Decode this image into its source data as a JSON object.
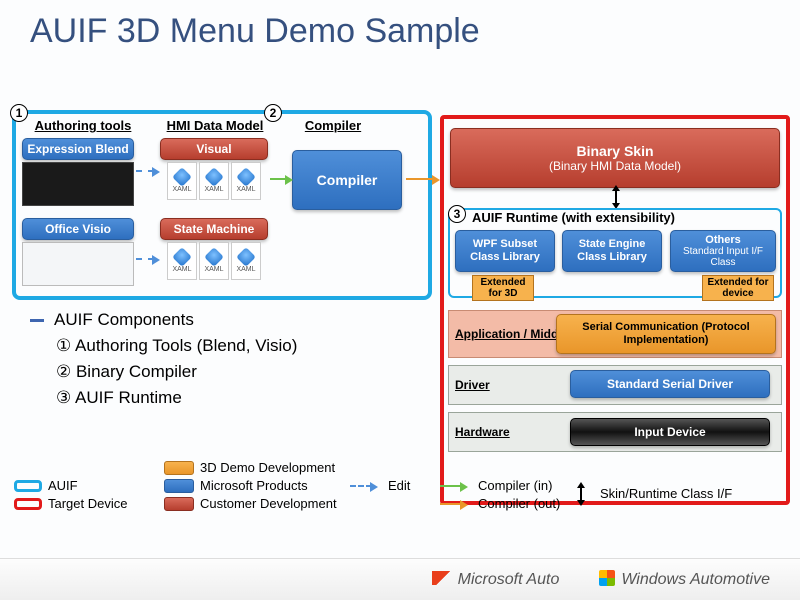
{
  "title": "AUIF 3D Menu Demo Sample",
  "nums": {
    "n1": "1",
    "n2": "2",
    "n3": "3"
  },
  "cols": {
    "authoring": "Authoring tools",
    "hmi": "HMI Data Model",
    "compiler": "Compiler"
  },
  "tools": {
    "blend": "Expression Blend",
    "visio": "Office Visio"
  },
  "hmi": {
    "visual": "Visual",
    "state": "State Machine",
    "xaml": "XAML"
  },
  "compiler": {
    "box": "Compiler"
  },
  "target": {
    "binary_skin": "Binary Skin",
    "binary_skin_sub": "(Binary HMI Data Model)",
    "runtime": "AUIF Runtime (with extensibility)",
    "wpf": "WPF Subset Class Library",
    "state_engine": "State Engine Class Library",
    "others": "Others",
    "others_sub": "Standard Input I/F Class",
    "ext_3d": "Extended for 3D",
    "ext_dev": "Extended for device",
    "appmw": "Application / Middle-ware",
    "serial_comm": "Serial Communication (Protocol Implementation)",
    "driver": "Driver",
    "std_serial": "Standard Serial Driver",
    "hardware": "Hardware",
    "input_device": "Input Device"
  },
  "bullets": {
    "head": "AUIF Components",
    "b1": "① Authoring Tools (Blend, Visio)",
    "b2": "② Binary Compiler",
    "b3": "③ AUIF Runtime"
  },
  "legend": {
    "auif": "AUIF",
    "target": "Target Device",
    "demo3d": "3D Demo Development",
    "msprod": "Microsoft Products",
    "custdev": "Customer Development",
    "edit": "Edit",
    "cin": "Compiler (in)",
    "cout": "Compiler (out)",
    "skinrt": "Skin/Runtime Class I/F"
  },
  "footer": {
    "msauto": "Microsoft Auto",
    "winauto": "Windows Automotive"
  }
}
